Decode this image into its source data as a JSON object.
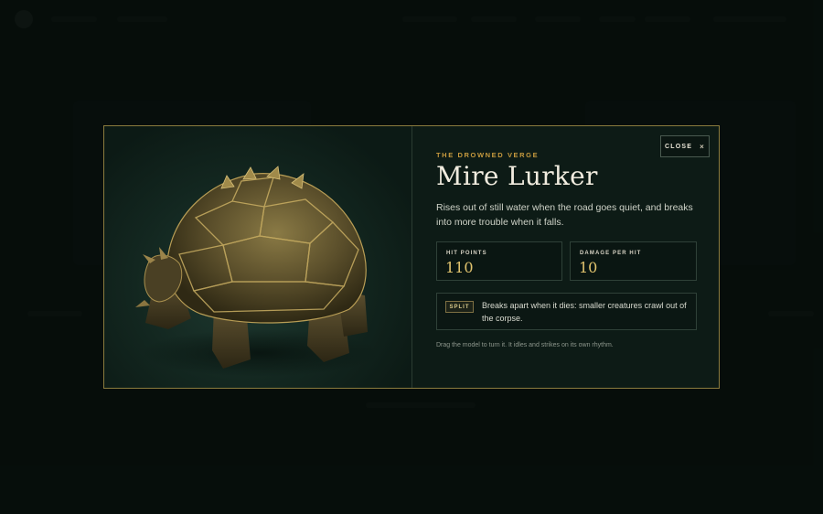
{
  "modal": {
    "region": "THE DROWNED VERGE",
    "title": "Mire Lurker",
    "description": "Rises out of still water when the road goes quiet, and breaks into more trouble when it falls.",
    "close_label": "CLOSE",
    "close_icon": "close-icon",
    "stats": [
      {
        "label": "HIT POINTS",
        "value": "110"
      },
      {
        "label": "DAMAGE PER HIT",
        "value": "10"
      }
    ],
    "ability": {
      "tag": "SPLIT",
      "text": "Breaks apart when it dies: smaller creatures crawl out of the corpse."
    },
    "hint": "Drag the model to turn it. It idles and strikes on its own rhythm.",
    "model_name": "armored-turtle-creature"
  },
  "colors": {
    "accent_gold": "#c79a3e",
    "stat_value": "#e2c46e",
    "modal_border": "#8b7c3e",
    "background": "#07100d"
  }
}
